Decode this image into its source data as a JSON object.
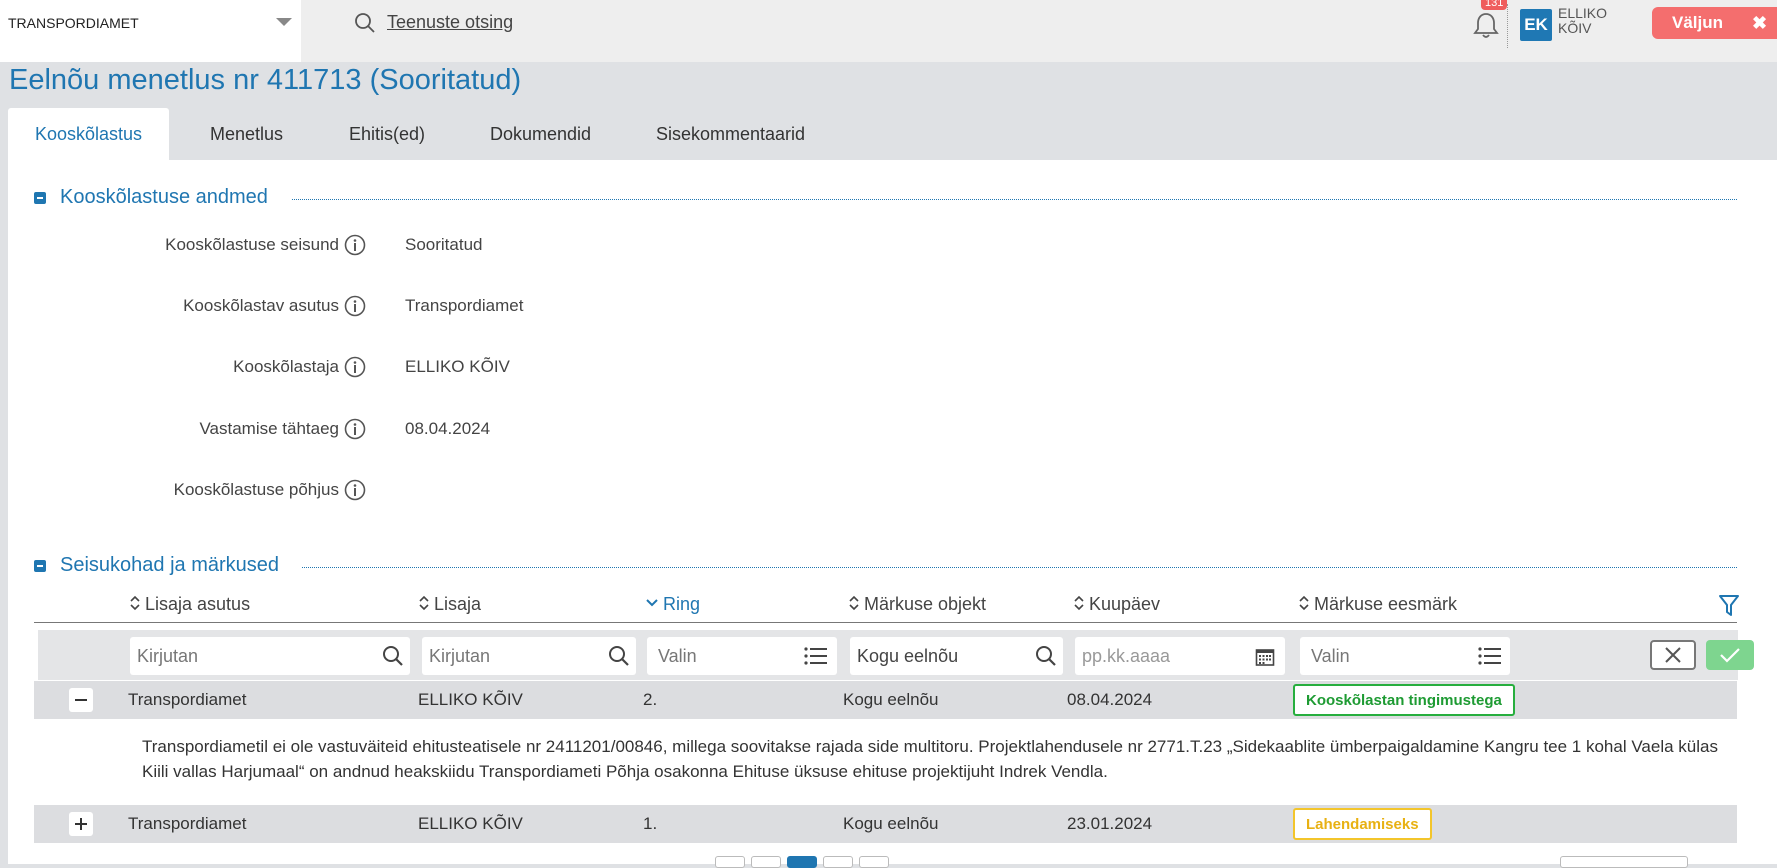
{
  "header": {
    "org_select": "TRANSPORDIAMET",
    "service_search": "Teenuste otsing",
    "notifications_count": "131",
    "user_initials": "EK",
    "user_name_first": "ELLIKO",
    "user_name_last": "KÕIV",
    "logout_label": "Väljun"
  },
  "page_title": "Eelnõu menetlus nr 411713 (Sooritatud)",
  "tabs": [
    {
      "label": "Kooskõlastus"
    },
    {
      "label": "Menetlus"
    },
    {
      "label": "Ehitis(ed)"
    },
    {
      "label": "Dokumendid"
    },
    {
      "label": "Sisekommentaarid"
    }
  ],
  "section_details": {
    "title": "Kooskõlastuse andmed",
    "fields": [
      {
        "label": "Kooskõlastuse seisund",
        "value": "Sooritatud"
      },
      {
        "label": "Kooskõlastav asutus",
        "value": "Transpordiamet"
      },
      {
        "label": "Kooskõlastaja",
        "value": "ELLIKO KÕIV"
      },
      {
        "label": "Vastamise tähtaeg",
        "value": "08.04.2024"
      },
      {
        "label": "Kooskõlastuse põhjus",
        "value": ""
      }
    ]
  },
  "section_remarks": {
    "title": "Seisukohad ja märkused",
    "columns": [
      "Lisaja asutus",
      "Lisaja",
      "Ring",
      "Märkuse objekt",
      "Kuupäev",
      "Märkuse eesmärk"
    ],
    "filters": {
      "agency": "Kirjutan",
      "author": "Kirjutan",
      "round": "Valin",
      "object": "Kogu eelnõu",
      "date": "pp.kk.aaaa",
      "purpose": "Valin"
    },
    "rows": [
      {
        "agency": "Transpordiamet",
        "author": "ELLIKO KÕIV",
        "round": "2.",
        "object": "Kogu eelnõu",
        "date": "08.04.2024",
        "purpose": "Kooskõlastan tingimustega",
        "purpose_color": "#27ae3e",
        "expanded": true,
        "comment": "Transpordiametil ei ole vastuväiteid ehitusteatisele nr 2411201/00846, millega soovitakse rajada side multitoru. Projektlahendusele nr 2771.T.23 „Sidekaablite ümberpaigaldamine Kangru tee 1 kohal Vaela külas Kiili vallas Harjumaal“ on andnud heakskiidu Transpordiameti Põhja osakonna Ehituse üksuse ehituse projektijuht Indrek Vendla."
      },
      {
        "agency": "Transpordiamet",
        "author": "ELLIKO KÕIV",
        "round": "1.",
        "object": "Kogu eelnõu",
        "date": "23.01.2024",
        "purpose": "Lahendamiseks",
        "purpose_color": "#f3c52b",
        "expanded": false
      }
    ]
  },
  "colors": {
    "accent": "#1f76b1",
    "logout": "#f46e6e",
    "confirm": "#7ed58f"
  }
}
